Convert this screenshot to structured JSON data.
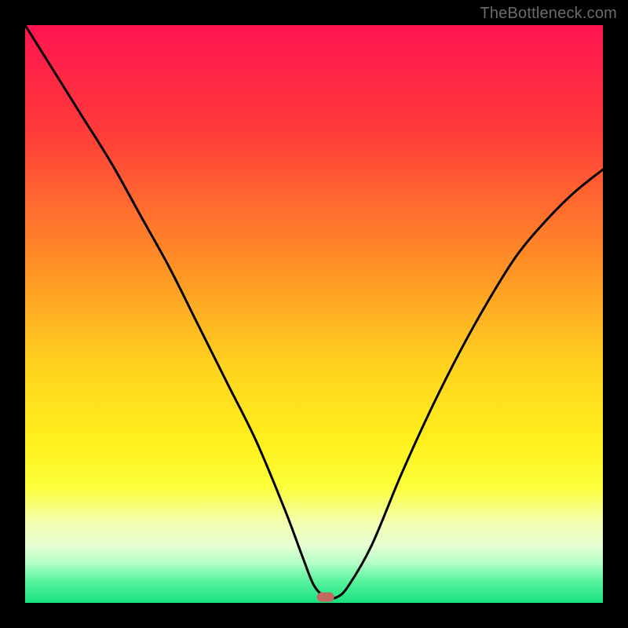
{
  "watermark": "TheBottleneck.com",
  "chart_data": {
    "type": "line",
    "title": "",
    "xlabel": "",
    "ylabel": "",
    "xlim": [
      0,
      100
    ],
    "ylim": [
      0,
      100
    ],
    "grid": false,
    "legend": false,
    "gradient_stops": [
      {
        "offset": 0,
        "color": "#ff1450"
      },
      {
        "offset": 18,
        "color": "#ff3a3a"
      },
      {
        "offset": 40,
        "color": "#ff8b27"
      },
      {
        "offset": 58,
        "color": "#ffd01f"
      },
      {
        "offset": 72,
        "color": "#fff01c"
      },
      {
        "offset": 80,
        "color": "#fbff3a"
      },
      {
        "offset": 86,
        "color": "#f3ffb0"
      },
      {
        "offset": 90,
        "color": "#e7ffd2"
      },
      {
        "offset": 93,
        "color": "#b6ffc8"
      },
      {
        "offset": 96,
        "color": "#5cf5a0"
      },
      {
        "offset": 100,
        "color": "#18e07f"
      }
    ],
    "series": [
      {
        "name": "bottleneck-curve",
        "x": [
          0,
          5,
          10,
          15,
          20,
          25,
          30,
          35,
          40,
          45,
          48,
          50,
          52,
          54,
          56,
          60,
          65,
          70,
          75,
          80,
          85,
          90,
          95,
          100
        ],
        "y": [
          100,
          92,
          84,
          76,
          67,
          58,
          48,
          38,
          28,
          16,
          8,
          3,
          1,
          1,
          3,
          10,
          22,
          33,
          43,
          52,
          60,
          66,
          71,
          75
        ]
      }
    ],
    "marker": {
      "x": 52,
      "y": 1,
      "color": "#c26a60"
    }
  }
}
